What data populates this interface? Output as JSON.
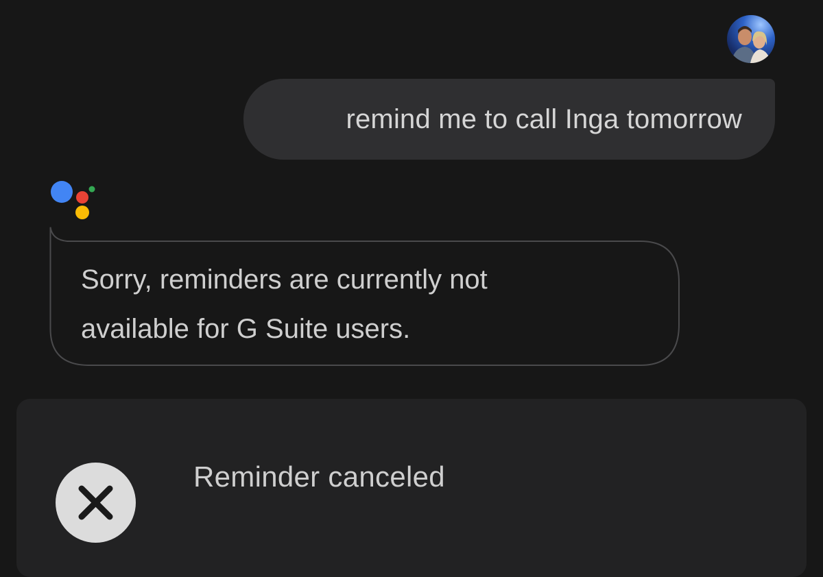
{
  "conversation": {
    "user": {
      "message": "remind me to call Inga tomorrow",
      "avatar_icon": "user-photo-avatar"
    },
    "assistant": {
      "logo_icon": "google-assistant-logo",
      "logo_colors": [
        "#4285f4",
        "#ea4335",
        "#fbbc05",
        "#34a853"
      ],
      "reply_line1": "Sorry, reminders are currently not",
      "reply_line2": "available for G Suite users."
    }
  },
  "reminder_card": {
    "status_text": "Reminder canceled",
    "status_icon": "close-icon"
  }
}
